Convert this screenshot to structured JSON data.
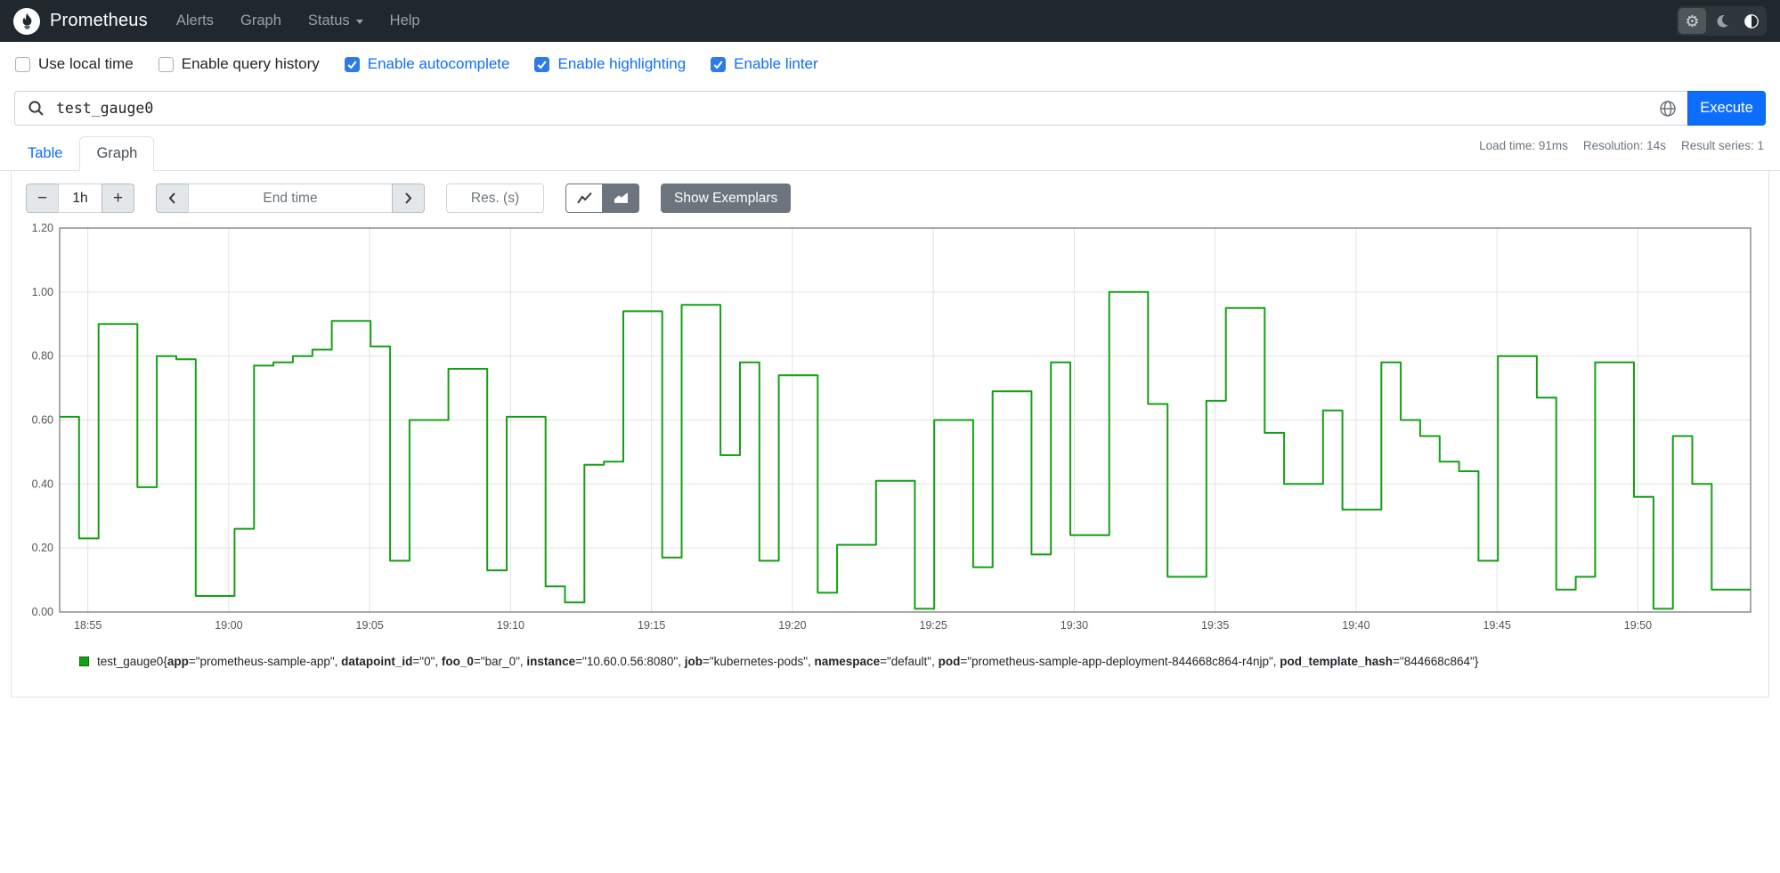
{
  "navbar": {
    "brand": "Prometheus",
    "items": [
      {
        "label": "Alerts"
      },
      {
        "label": "Graph"
      },
      {
        "label": "Status",
        "caret": true
      },
      {
        "label": "Help"
      }
    ]
  },
  "options": [
    {
      "label": "Use local time",
      "checked": false
    },
    {
      "label": "Enable query history",
      "checked": false
    },
    {
      "label": "Enable autocomplete",
      "checked": true
    },
    {
      "label": "Enable highlighting",
      "checked": true
    },
    {
      "label": "Enable linter",
      "checked": true
    }
  ],
  "query": {
    "value": "test_gauge0",
    "execute_label": "Execute"
  },
  "stats": [
    "Load time: 91ms",
    "Resolution: 14s",
    "Result series: 1"
  ],
  "tabs": [
    {
      "label": "Table",
      "active": false
    },
    {
      "label": "Graph",
      "active": true
    }
  ],
  "controls": {
    "minus_label": "−",
    "range_value": "1h",
    "plus_label": "+",
    "end_time_placeholder": "End time",
    "res_placeholder": "Res. (s)",
    "show_exemplars_label": "Show Exemplars"
  },
  "chart_data": {
    "type": "line",
    "line_style": "step",
    "line_color": "#14a014",
    "grid": true,
    "legend_position": "bottom",
    "ylim": [
      0,
      1.2
    ],
    "y_ticks": [
      "0.00",
      "0.20",
      "0.40",
      "0.60",
      "0.80",
      "1.00",
      "1.20"
    ],
    "x_range_minutes": 60,
    "x_ticks": [
      {
        "label": "18:55",
        "min": 1
      },
      {
        "label": "19:00",
        "min": 6
      },
      {
        "label": "19:05",
        "min": 11
      },
      {
        "label": "19:10",
        "min": 16
      },
      {
        "label": "19:15",
        "min": 21
      },
      {
        "label": "19:20",
        "min": 26
      },
      {
        "label": "19:25",
        "min": 31
      },
      {
        "label": "19:30",
        "min": 36
      },
      {
        "label": "19:35",
        "min": 41
      },
      {
        "label": "19:40",
        "min": 46
      },
      {
        "label": "19:45",
        "min": 51
      },
      {
        "label": "19:50",
        "min": 56
      }
    ],
    "values": [
      0.61,
      0.23,
      0.9,
      0.9,
      0.39,
      0.8,
      0.79,
      0.05,
      0.05,
      0.26,
      0.77,
      0.78,
      0.8,
      0.82,
      0.91,
      0.91,
      0.83,
      0.16,
      0.6,
      0.6,
      0.76,
      0.76,
      0.13,
      0.61,
      0.61,
      0.08,
      0.03,
      0.46,
      0.47,
      0.94,
      0.94,
      0.17,
      0.96,
      0.96,
      0.49,
      0.78,
      0.16,
      0.74,
      0.74,
      0.06,
      0.21,
      0.21,
      0.41,
      0.41,
      0.01,
      0.6,
      0.6,
      0.14,
      0.69,
      0.69,
      0.18,
      0.78,
      0.24,
      0.24,
      1.0,
      1.0,
      0.65,
      0.11,
      0.11,
      0.66,
      0.95,
      0.95,
      0.56,
      0.4,
      0.4,
      0.63,
      0.32,
      0.32,
      0.78,
      0.6,
      0.55,
      0.47,
      0.44,
      0.16,
      0.8,
      0.8,
      0.67,
      0.07,
      0.11,
      0.78,
      0.78,
      0.36,
      0.01,
      0.55,
      0.4,
      0.07,
      0.07
    ],
    "series_name": "test_gauge0",
    "legend_labels": [
      {
        "name": "app",
        "value": "prometheus-sample-app"
      },
      {
        "name": "datapoint_id",
        "value": "0"
      },
      {
        "name": "foo_0",
        "value": "bar_0"
      },
      {
        "name": "instance",
        "value": "10.60.0.56:8080"
      },
      {
        "name": "job",
        "value": "kubernetes-pods"
      },
      {
        "name": "namespace",
        "value": "default"
      },
      {
        "name": "pod",
        "value": "prometheus-sample-app-deployment-844668c864-r4njp"
      },
      {
        "name": "pod_template_hash",
        "value": "844668c864"
      }
    ]
  }
}
